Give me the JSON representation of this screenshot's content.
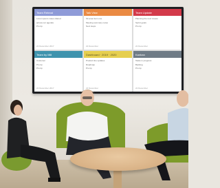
{
  "photo": {
    "panels": [
      {
        "header": "Team Retreat",
        "color": "#8f9bd8",
        "lines": [
          "Lorem ipsum notes shared",
          "across our agenda",
          "Pro tip"
        ],
        "footer": "22 December 2017"
      },
      {
        "header": "Talk View",
        "color": "#ea8a43",
        "lines": [
          "Sit amet item one",
          "Meeting summary notes",
          "Next steps"
        ],
        "footer": "22 December"
      },
      {
        "header": "Team Update",
        "color": "#d33a4a",
        "lines": [
          "Planning the next review",
          "Sprint goals",
          "Pro tip"
        ],
        "footer": "22 December"
      },
      {
        "header": "Team by Mill",
        "color": "#3f93ad",
        "lines": [
          "Customer",
          "Pro tip",
          "Pro tip"
        ],
        "footer": "22 December 2017"
      },
      {
        "header": "Dashboard · 2019 · 2020",
        "color": "#e6cf4f",
        "lines": [
          "Product line updates",
          "Roadmap",
          "Pro tip"
        ],
        "footer": "22 December"
      },
      {
        "header": "Kanban",
        "color": "#6f7b86",
        "lines": [
          "Tasks in progress",
          "Backlog",
          "Pro tip"
        ],
        "footer": "22 December"
      }
    ]
  }
}
